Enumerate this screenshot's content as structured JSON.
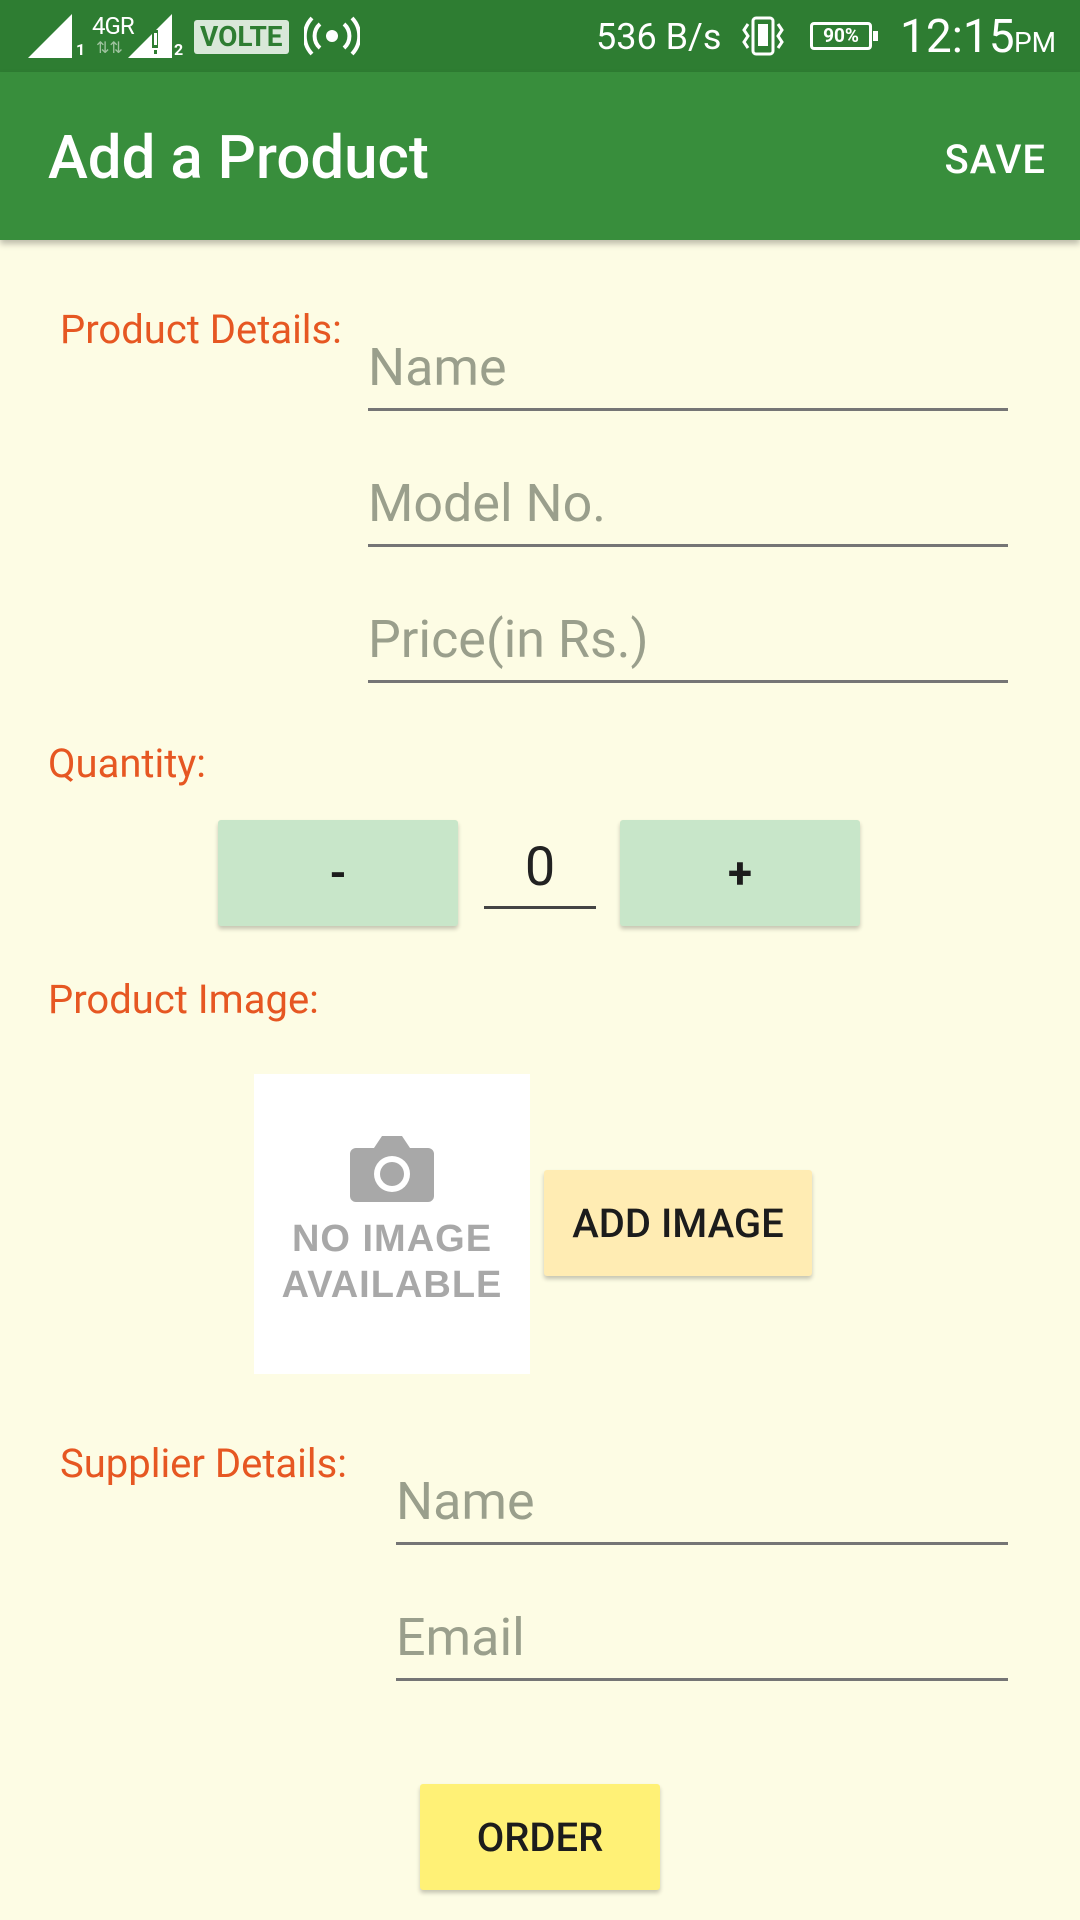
{
  "status_bar": {
    "network_label": "4GR",
    "sim1": "1",
    "sim2": "2",
    "volte": "VOLTE",
    "speed": "536 B/s",
    "battery": "90%",
    "time": "12:15",
    "ampm": "PM"
  },
  "app_bar": {
    "title": "Add a Product",
    "save_label": "SAVE"
  },
  "product_details": {
    "label": "Product Details:",
    "name_placeholder": "Name",
    "model_placeholder": "Model No.",
    "price_placeholder": "Price(in Rs.)"
  },
  "quantity": {
    "label": "Quantity:",
    "decrement_label": "-",
    "value": "0",
    "increment_label": "+"
  },
  "product_image": {
    "label": "Product Image:",
    "placeholder_line1": "NO IMAGE",
    "placeholder_line2": "AVAILABLE",
    "add_image_label": "ADD IMAGE"
  },
  "supplier_details": {
    "label": "Supplier Details:",
    "name_placeholder": "Name",
    "email_placeholder": "Email"
  },
  "order_label": "ORDER",
  "colors": {
    "status_bar": "#2E7D32",
    "app_bar": "#388E3C",
    "background": "#FDFCE4",
    "label_text": "#E65722",
    "quantity_button": "#C8E6C9",
    "add_image_button": "#FFECB3",
    "order_button": "#FFF176"
  },
  "icons": {
    "camera": "camera-icon",
    "signal": "signal-icon",
    "hotspot": "hotspot-icon",
    "vibrate": "vibrate-icon",
    "battery": "battery-icon"
  }
}
